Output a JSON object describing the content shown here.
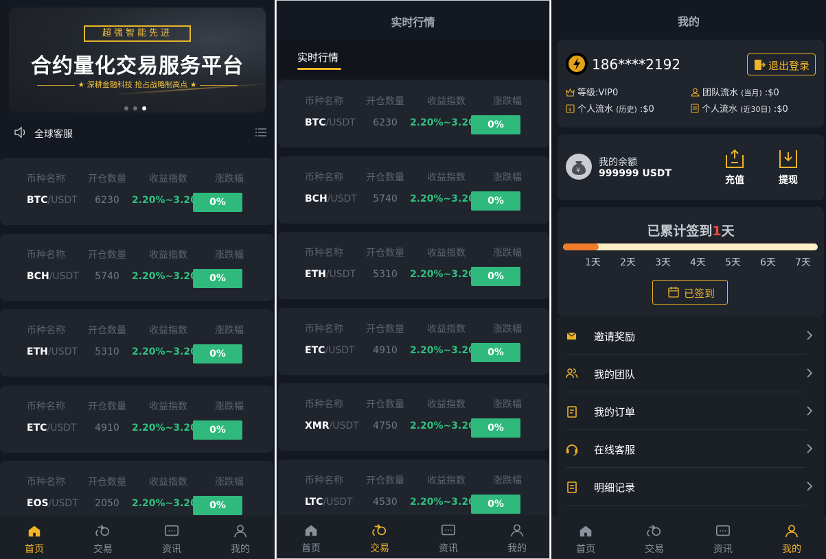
{
  "home": {
    "banner": {
      "tag": "超强智能先进",
      "title": "合约量化交易服务平台",
      "subtitle": "★ 深耕金融科技  抢占战略制高点 ★"
    },
    "notice": "全球客服",
    "headers": [
      "币种名称",
      "开仓数量",
      "收益指数",
      "涨跌幅"
    ],
    "rows": [
      {
        "base": "BTC",
        "quote": "/USDT",
        "qty": "6230",
        "range": "2.20%~3.20%",
        "change": "0%"
      },
      {
        "base": "BCH",
        "quote": "/USDT",
        "qty": "5740",
        "range": "2.20%~3.20%",
        "change": "0%"
      },
      {
        "base": "ETH",
        "quote": "/USDT",
        "qty": "5310",
        "range": "2.20%~3.20%",
        "change": "0%"
      },
      {
        "base": "ETC",
        "quote": "/USDT",
        "qty": "4910",
        "range": "2.20%~3.20%",
        "change": "0%"
      },
      {
        "base": "EOS",
        "quote": "/USDT",
        "qty": "2050",
        "range": "2.20%~3.20%",
        "change": "0%"
      }
    ]
  },
  "market": {
    "title": "实时行情",
    "tab": "实时行情",
    "headers": [
      "币种名称",
      "开仓数量",
      "收益指数",
      "涨跌幅"
    ],
    "rows": [
      {
        "base": "BTC",
        "quote": "/USDT",
        "qty": "6230",
        "range": "2.20%~3.20%",
        "change": "0%"
      },
      {
        "base": "BCH",
        "quote": "/USDT",
        "qty": "5740",
        "range": "2.20%~3.20%",
        "change": "0%"
      },
      {
        "base": "ETH",
        "quote": "/USDT",
        "qty": "5310",
        "range": "2.20%~3.20%",
        "change": "0%"
      },
      {
        "base": "ETC",
        "quote": "/USDT",
        "qty": "4910",
        "range": "2.20%~3.20%",
        "change": "0%"
      },
      {
        "base": "XMR",
        "quote": "/USDT",
        "qty": "4750",
        "range": "2.20%~3.20%",
        "change": "0%"
      },
      {
        "base": "LTC",
        "quote": "/USDT",
        "qty": "4530",
        "range": "2.20%~3.20%",
        "change": "0%"
      }
    ]
  },
  "mine": {
    "title": "我的",
    "phone": "186****2192",
    "logout": "退出登录",
    "level": "等级:VIP0",
    "team_flow": "团队流水",
    "team_flow_note": "(当月)",
    "team_flow_val": ":$0",
    "personal_hist": "个人流水",
    "personal_hist_note": "(历史)",
    "personal_hist_val": ":$0",
    "personal_30": "个人流水",
    "personal_30_note": "(近30日)",
    "personal_30_val": ":$0",
    "balance_label": "我的余额",
    "balance_value": "999999 USDT",
    "recharge": "充值",
    "withdraw": "提现",
    "sign_prefix": "已累计签到",
    "sign_days": "1",
    "sign_suffix": "天",
    "sign_progress": 0.14,
    "day_labels": [
      "1天",
      "2天",
      "3天",
      "4天",
      "5天",
      "6天",
      "7天"
    ],
    "signed_button": "已签到",
    "menu": [
      "邀请奖励",
      "我的团队",
      "我的订单",
      "在线客服",
      "明细记录"
    ]
  },
  "tabs": [
    "首页",
    "交易",
    "资讯",
    "我的"
  ],
  "colors": {
    "accent": "#f0b429",
    "up": "#2fb97c",
    "bg": "#141820",
    "card": "#1f242d"
  }
}
